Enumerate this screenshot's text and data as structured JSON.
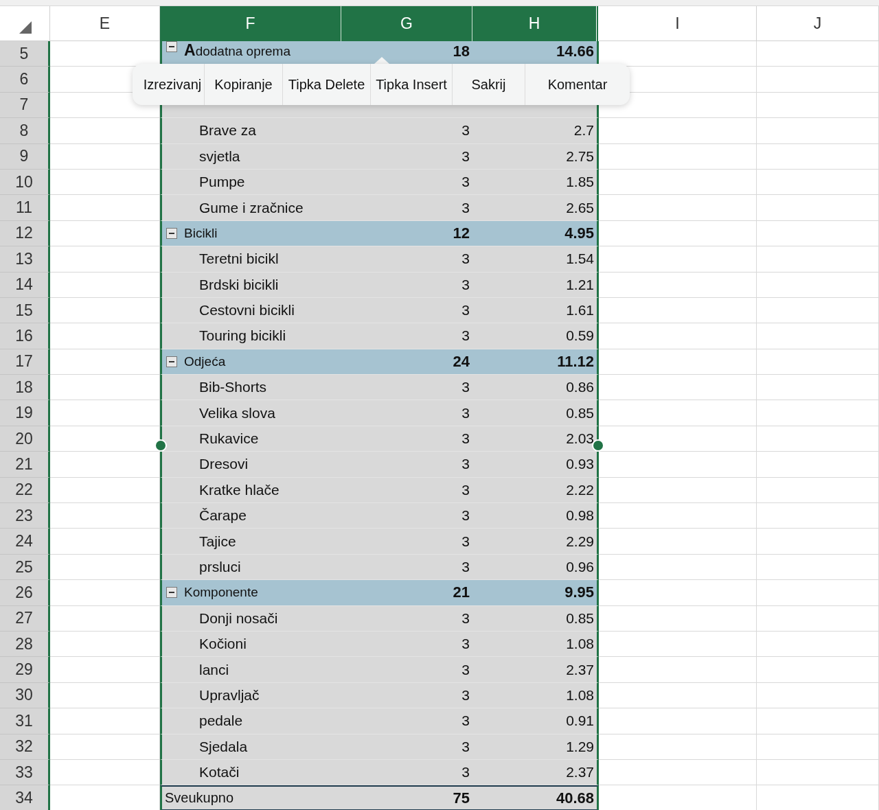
{
  "column_headers": [
    {
      "label": "E",
      "selected": false
    },
    {
      "label": "F",
      "selected": true
    },
    {
      "label": "G",
      "selected": true
    },
    {
      "label": "H",
      "selected": true
    },
    {
      "label": "I",
      "selected": false
    },
    {
      "label": "J",
      "selected": false
    }
  ],
  "rows": [
    {
      "number": "5",
      "kind": "category",
      "expanded": true,
      "label": "**A**dodatna oprema",
      "count": "18",
      "value": "14.66"
    },
    {
      "number": "6",
      "kind": "covered"
    },
    {
      "number": "7",
      "kind": "hidden"
    },
    {
      "number": "8",
      "kind": "item",
      "label": "Brave za",
      "count": "3",
      "value": "2.7"
    },
    {
      "number": "9",
      "kind": "item",
      "label": "svjetla",
      "count": "3",
      "value": "2.75"
    },
    {
      "number": "10",
      "kind": "item",
      "label": "Pumpe",
      "count": "3",
      "value": "1.85"
    },
    {
      "number": "11",
      "kind": "item",
      "label": "Gume i zračnice",
      "count": "3",
      "value": "2.65"
    },
    {
      "number": "12",
      "kind": "category",
      "expanded": true,
      "label": "Bicikli",
      "count": "12",
      "value": "4.95"
    },
    {
      "number": "13",
      "kind": "item",
      "label": "Teretni bicikl",
      "count": "3",
      "value": "1.54"
    },
    {
      "number": "14",
      "kind": "item",
      "label": "Brdski bicikli",
      "count": "3",
      "value": "1.21"
    },
    {
      "number": "15",
      "kind": "item",
      "label": "Cestovni bicikli",
      "count": "3",
      "value": "1.61"
    },
    {
      "number": "16",
      "kind": "item",
      "label": "Touring bicikli",
      "count": "3",
      "value": "0.59"
    },
    {
      "number": "17",
      "kind": "category",
      "expanded": true,
      "label": "Odjeća",
      "count": "24",
      "value": "11.12"
    },
    {
      "number": "18",
      "kind": "item",
      "label": "Bib-Shorts",
      "count": "3",
      "value": "0.86"
    },
    {
      "number": "19",
      "kind": "item",
      "label": "Velika slova",
      "count": "3",
      "value": "0.85"
    },
    {
      "number": "20",
      "kind": "item",
      "label": "Rukavice",
      "count": "3",
      "value": "2.03"
    },
    {
      "number": "21",
      "kind": "item",
      "label": "Dresovi",
      "count": "3",
      "value": "0.93"
    },
    {
      "number": "22",
      "kind": "item",
      "label": "Kratke hlače",
      "count": "3",
      "value": "2.22"
    },
    {
      "number": "23",
      "kind": "item",
      "label": "Čarape",
      "count": "3",
      "value": "0.98"
    },
    {
      "number": "24",
      "kind": "item",
      "label": "Tajice",
      "count": "3",
      "value": "2.29"
    },
    {
      "number": "25",
      "kind": "item",
      "label": "prsluci",
      "count": "3",
      "value": "0.96"
    },
    {
      "number": "26",
      "kind": "category",
      "expanded": true,
      "label": "Komponente",
      "count": "21",
      "value": "9.95"
    },
    {
      "number": "27",
      "kind": "item",
      "label": "Donji nosači",
      "count": "3",
      "value": "0.85"
    },
    {
      "number": "28",
      "kind": "item",
      "label": "Kočioni",
      "count": "3",
      "value": "1.08"
    },
    {
      "number": "29",
      "kind": "item",
      "label": "lanci",
      "count": "3",
      "value": "2.37"
    },
    {
      "number": "30",
      "kind": "item",
      "label": "Upravljač",
      "count": "3",
      "value": "1.08"
    },
    {
      "number": "31",
      "kind": "item",
      "label": "pedale",
      "count": "3",
      "value": "0.91"
    },
    {
      "number": "32",
      "kind": "item",
      "label": "Sjedala",
      "count": "3",
      "value": "1.29"
    },
    {
      "number": "33",
      "kind": "item",
      "label": "Kotači",
      "count": "3",
      "value": "2.37"
    },
    {
      "number": "34",
      "kind": "total",
      "label": "Sveukupno",
      "count": "75",
      "value": "40.68"
    }
  ],
  "context_menu": [
    "Izrezivanj",
    "Kopiranje",
    "Tipka Delete",
    "Tipka Insert",
    "Sakrij",
    "Komentar"
  ]
}
